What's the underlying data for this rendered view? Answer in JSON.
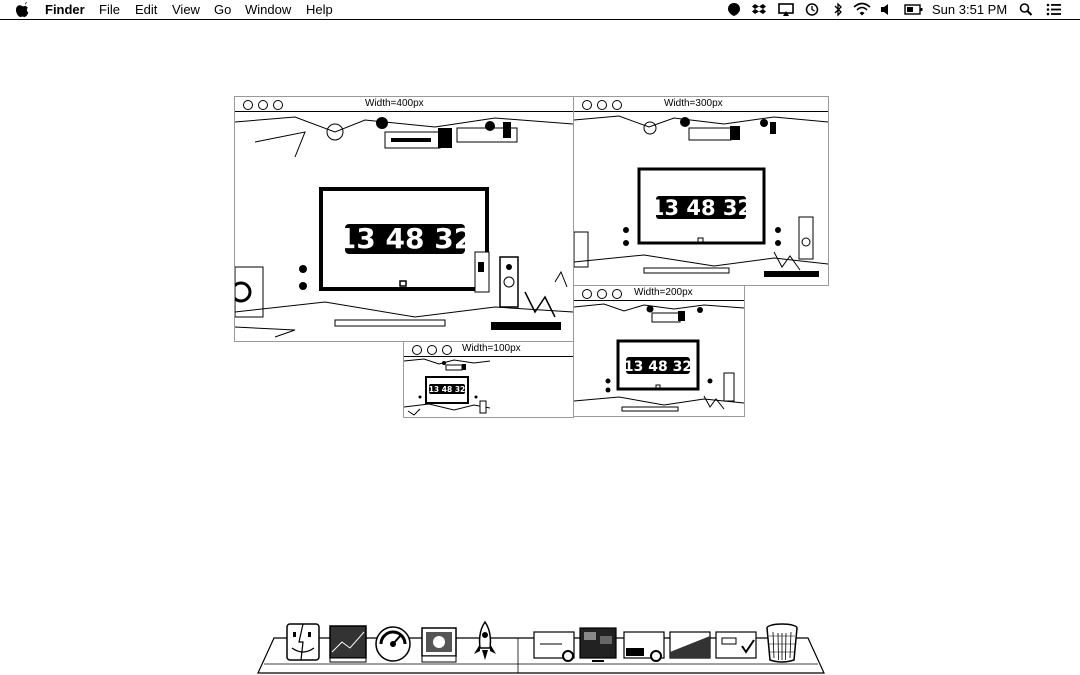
{
  "menubar": {
    "app_name": "Finder",
    "menus": [
      "File",
      "Edit",
      "View",
      "Go",
      "Window",
      "Help"
    ],
    "clock": "Sun 3:51 PM",
    "status_icons": [
      "evernote-icon",
      "dropbox-icon",
      "airplay-icon",
      "time-machine-icon",
      "bluetooth-icon",
      "wifi-icon",
      "volume-icon",
      "battery-icon"
    ]
  },
  "windows": [
    {
      "title": "Width=400px",
      "time": "13 48 32"
    },
    {
      "title": "Width=300px",
      "time": "13 48 32"
    },
    {
      "title": "Width=200px",
      "time": "13 48 32"
    },
    {
      "title": "Width=100px",
      "time": "13 48 32"
    }
  ],
  "dock": {
    "items": [
      "finder-icon",
      "photo-icon",
      "dashboard-icon",
      "preview-icon",
      "launchpad-icon",
      "screenshot-1-icon",
      "screenshot-2-icon",
      "screenshot-3-icon",
      "screenshot-4-icon",
      "screenshot-5-icon",
      "trash-icon"
    ]
  }
}
